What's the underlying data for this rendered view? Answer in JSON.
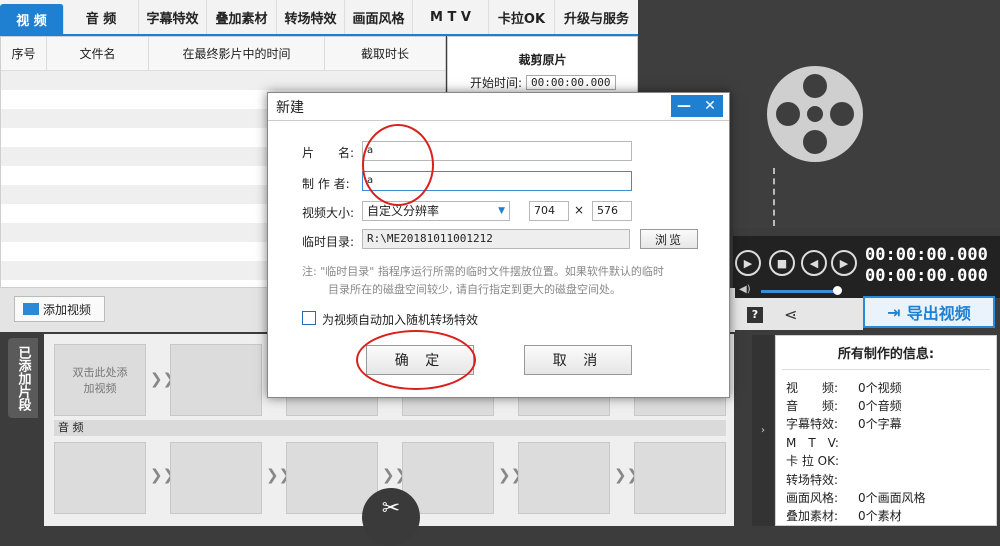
{
  "tabs": [
    "视 频",
    "音 频",
    "字幕特效",
    "叠加素材",
    "转场特效",
    "画面风格",
    "M T V",
    "卡拉OK",
    "升级与服务"
  ],
  "list_headers": [
    "序号",
    "文件名",
    "在最终影片中的时间",
    "截取时长"
  ],
  "crop": {
    "title": "裁剪原片",
    "start_label": "开始时间:",
    "start_value": "00:00:00.000"
  },
  "player": {
    "time_current": "00:00:00.000",
    "time_total": "00:00:00.000",
    "volume": 1.0
  },
  "export_label": "导出视频",
  "add_video_label": "添加视频",
  "storyboard": {
    "side_tab": "已添加片段",
    "placeholder": "双击此处添加视频",
    "audio_label": "音 频"
  },
  "info": {
    "title": "所有制作的信息:",
    "rows": [
      {
        "k": "视　　频:",
        "v": "0个视频"
      },
      {
        "k": "音　　频:",
        "v": "0个音频"
      },
      {
        "k": "字幕特效:",
        "v": "0个字幕"
      },
      {
        "k": "M　T　V:",
        "v": ""
      },
      {
        "k": "卡 拉 OK:",
        "v": ""
      },
      {
        "k": "转场特效:",
        "v": ""
      },
      {
        "k": "画面风格:",
        "v": "0个画面风格"
      },
      {
        "k": "叠加素材:",
        "v": "0个素材"
      }
    ]
  },
  "dialog": {
    "title": "新建",
    "name_label": "片　　名:",
    "name_value": "a",
    "author_label": "制 作 者:",
    "author_value": "a",
    "size_label": "视频大小:",
    "size_select": "自定义分辨率",
    "width": "704",
    "times": "×",
    "height": "576",
    "temp_label": "临时目录:",
    "temp_value": "R:\\ME20181011001212",
    "browse": "浏览",
    "note1": "注: \"临时目录\" 指程序运行所需的临时文件摆放位置。如果软件默认的临时",
    "note2": "目录所在的磁盘空间较少, 请自行指定到更大的磁盘空间处。",
    "checkbox_label": "为视频自动加入随机转场特效",
    "ok": "确 定",
    "cancel": "取 消"
  },
  "colors": {
    "accent": "#1f80d2",
    "annotation": "#d9211c"
  }
}
